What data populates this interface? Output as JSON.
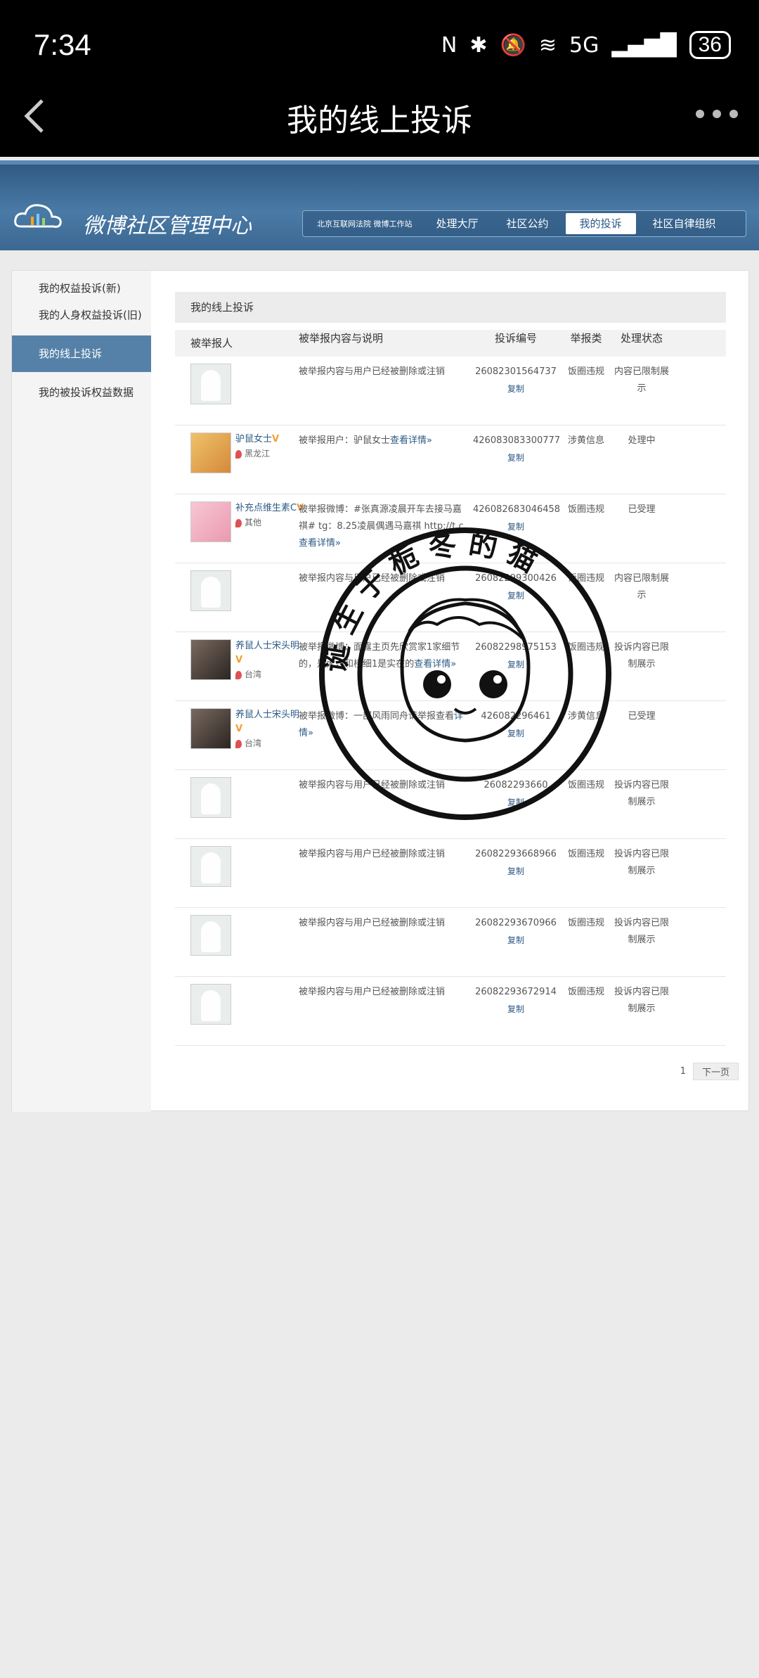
{
  "status": {
    "time": "7:34",
    "network": "5G",
    "battery": "36"
  },
  "titlebar": {
    "title": "我的线上投诉"
  },
  "site": {
    "name": "微博社区管理中心",
    "nav": [
      "北京互联网法院\n微博工作站",
      "处理大厅",
      "社区公约",
      "我的投诉",
      "社区自律组织"
    ]
  },
  "sidebar": {
    "items": [
      "我的权益投诉(新)",
      "我的人身权益投诉(旧)",
      "我的线上投诉",
      "我的被投诉权益数据"
    ]
  },
  "main": {
    "heading": "我的线上投诉",
    "columns": [
      "被举报人",
      "被举报内容与说明",
      "投诉编号",
      "举报类",
      "处理状态"
    ],
    "copy_label": "复制",
    "rows": [
      {
        "name": "",
        "loc": "",
        "content": "被举报内容与用户已经被删除或注销",
        "link": "",
        "num": "26082301564737",
        "type": "饭圈违规",
        "status": "内容已限制展示"
      },
      {
        "name": "驴鼠女士",
        "loc": "黑龙江",
        "content": "被举报用户：驴鼠女士",
        "link": "查看详情»",
        "num": "426083083300777",
        "type": "涉黄信息",
        "status": "处理中"
      },
      {
        "name": "补充点维生素C",
        "loc": "其他",
        "content": "被举报微博：#张真源凌晨开车去接马嘉祺# tg：8.25凌晨偶遇马嘉祺 http://t.c",
        "link": "查看详情»",
        "num": "426082683046458",
        "type": "饭圈违规",
        "status": "已受理"
      },
      {
        "name": "",
        "loc": "",
        "content": "被举报内容与用户已经被删除或注销",
        "link": "",
        "num": "26082299300426",
        "type": "饭圈违规",
        "status": "内容已限制展示"
      },
      {
        "name": "养鼠人士宋头明",
        "loc": "台湾",
        "content": "被举报微博：面露主页先欣赏家1家细节的，是大，和楼细1是实在的",
        "link": "查看详情»",
        "num": "26082298975153",
        "type": "饭圈违规",
        "status": "投诉内容已限制展示"
      },
      {
        "name": "养鼠人士宋头明",
        "loc": "台湾",
        "content": "被举报微博：一部风雨同舟请举报查看",
        "link": "详情»",
        "num": "426082296461",
        "type": "涉黄信息",
        "status": "已受理"
      },
      {
        "name": "",
        "loc": "",
        "content": "被举报内容与用户已经被删除或注销",
        "link": "",
        "num": "26082293660",
        "type": "饭圈违规",
        "status": "投诉内容已限制展示"
      },
      {
        "name": "",
        "loc": "",
        "content": "被举报内容与用户已经被删除或注销",
        "link": "",
        "num": "26082293668966",
        "type": "饭圈违规",
        "status": "投诉内容已限制展示"
      },
      {
        "name": "",
        "loc": "",
        "content": "被举报内容与用户已经被删除或注销",
        "link": "",
        "num": "26082293670966",
        "type": "饭圈违规",
        "status": "投诉内容已限制展示"
      },
      {
        "name": "",
        "loc": "",
        "content": "被举报内容与用户已经被删除或注销",
        "link": "",
        "num": "26082293672914",
        "type": "饭圈违规",
        "status": "投诉内容已限制展示"
      }
    ],
    "pager": {
      "page": "1",
      "next": "下一页"
    }
  },
  "stamp": {
    "text": "诞生于栀冬的猫"
  }
}
